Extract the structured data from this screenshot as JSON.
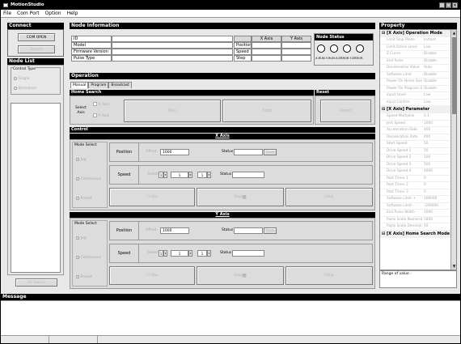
{
  "app": {
    "title": "MotionStudio",
    "min": "_",
    "max": "□",
    "close": "×"
  },
  "menu": [
    "File",
    "Com Port",
    "Option",
    "Help"
  ],
  "connect": {
    "title": "Connect",
    "com_open": "COM OPEN",
    "search": "Search"
  },
  "nodelist": {
    "title": "Node List",
    "control_type": "Control Type",
    "option_single": "Single",
    "option_broadcast": "Broadcast",
    "io_status": "IO Status"
  },
  "node_info": {
    "title": "Node Information",
    "rows": [
      "ID",
      "Model",
      "Firmware Version",
      "Pulse Type"
    ],
    "axis_headers": [
      "X Axis",
      "Y Axis"
    ],
    "axis_rows": [
      "Position",
      "Speed",
      "Step"
    ],
    "status_title": "Node Status",
    "status_labels": [
      "X-RUN",
      "Y-RUN",
      "X-ERROR",
      "Y-ERROR"
    ]
  },
  "operation": {
    "title": "Operation",
    "tabs": [
      "Manual",
      "Program",
      "Broadcast"
    ],
    "home_search": {
      "title": "Home Search",
      "select_axis": "Select Axis",
      "x_axis": "X Axis",
      "y_axis": "Y Axis",
      "run": "Run",
      "stop": "Stop"
    },
    "reset": {
      "title": "Reset",
      "button": "Reset"
    }
  },
  "control": {
    "title": "Control",
    "axes": [
      {
        "name": "X Axis",
        "mode_select": "Mode Select",
        "modes": [
          "Jog",
          "Continuous",
          "Preset"
        ],
        "position_label": "Position",
        "offset_label": "Offset",
        "offset_value": "1000",
        "status_label": "Status",
        "clear": "Clear",
        "speed_label": "Speed",
        "select_label": "Select",
        "select_value": "1",
        "step_value": "1",
        "step2_value": "1",
        "status2_label": "Status",
        "ccw": "CCW",
        "stop": "Stop",
        "cw": "CW"
      },
      {
        "name": "Y Axis",
        "mode_select": "Mode Select",
        "modes": [
          "Jog",
          "Continuous",
          "Preset"
        ],
        "position_label": "Position",
        "offset_label": "Offset",
        "offset_value": "1000",
        "status_label": "Status",
        "clear": "Clear",
        "speed_label": "Speed",
        "select_label": "Select",
        "select_value": "1",
        "step_value": "1",
        "step2_value": "1",
        "status2_label": "Status",
        "ccw": "CCW",
        "stop": "Stop",
        "cw": "CW"
      }
    ]
  },
  "property": {
    "title": "Property",
    "categories": [
      {
        "name": "[X Axis] Operation Mode",
        "rows": [
          [
            "Limit Stop Mode",
            "Instant"
          ],
          [
            "Limit Active Level",
            "Low"
          ],
          [
            "Z Curve",
            "Disable"
          ],
          [
            "End Pulse",
            "Disable"
          ],
          [
            "Deceleration Value",
            "Auto"
          ],
          [
            "Software Limit",
            "Disable"
          ],
          [
            "Power On Home Search",
            "Disable"
          ],
          [
            "Power On Program Start",
            "Disable"
          ],
          [
            "Input Level",
            "Low"
          ],
          [
            "Input Control",
            "Low"
          ]
        ]
      },
      {
        "name": "[X Axis] Parameter",
        "rows": [
          [
            "Speed Multiplier",
            "0.1"
          ],
          [
            "Jerk Speed",
            "1000"
          ],
          [
            "Acceleration Rate",
            "400"
          ],
          [
            "Deceleration Rate",
            "400"
          ],
          [
            "Start Speed",
            "50"
          ],
          [
            "Drive Speed 1",
            "50"
          ],
          [
            "Drive Speed 2",
            "100"
          ],
          [
            "Drive Speed 3",
            "500"
          ],
          [
            "Drive Speed 4",
            "4000"
          ],
          [
            "Post Timer 1",
            "0"
          ],
          [
            "Post Timer 2",
            "0"
          ],
          [
            "Post Timer 3",
            "0"
          ],
          [
            "Software Limit +",
            "100000"
          ],
          [
            "Software Limit -",
            "-100000"
          ],
          [
            "End Pulse Width",
            "1000"
          ],
          [
            "Pulse Scale Numerator",
            "1000"
          ],
          [
            "Pulse Scale Denominator",
            "10"
          ]
        ]
      },
      {
        "name": "[X Axis] Home Search Mode",
        "rows": []
      }
    ],
    "range_label": "Range of value :"
  },
  "message": {
    "title": "Message"
  }
}
